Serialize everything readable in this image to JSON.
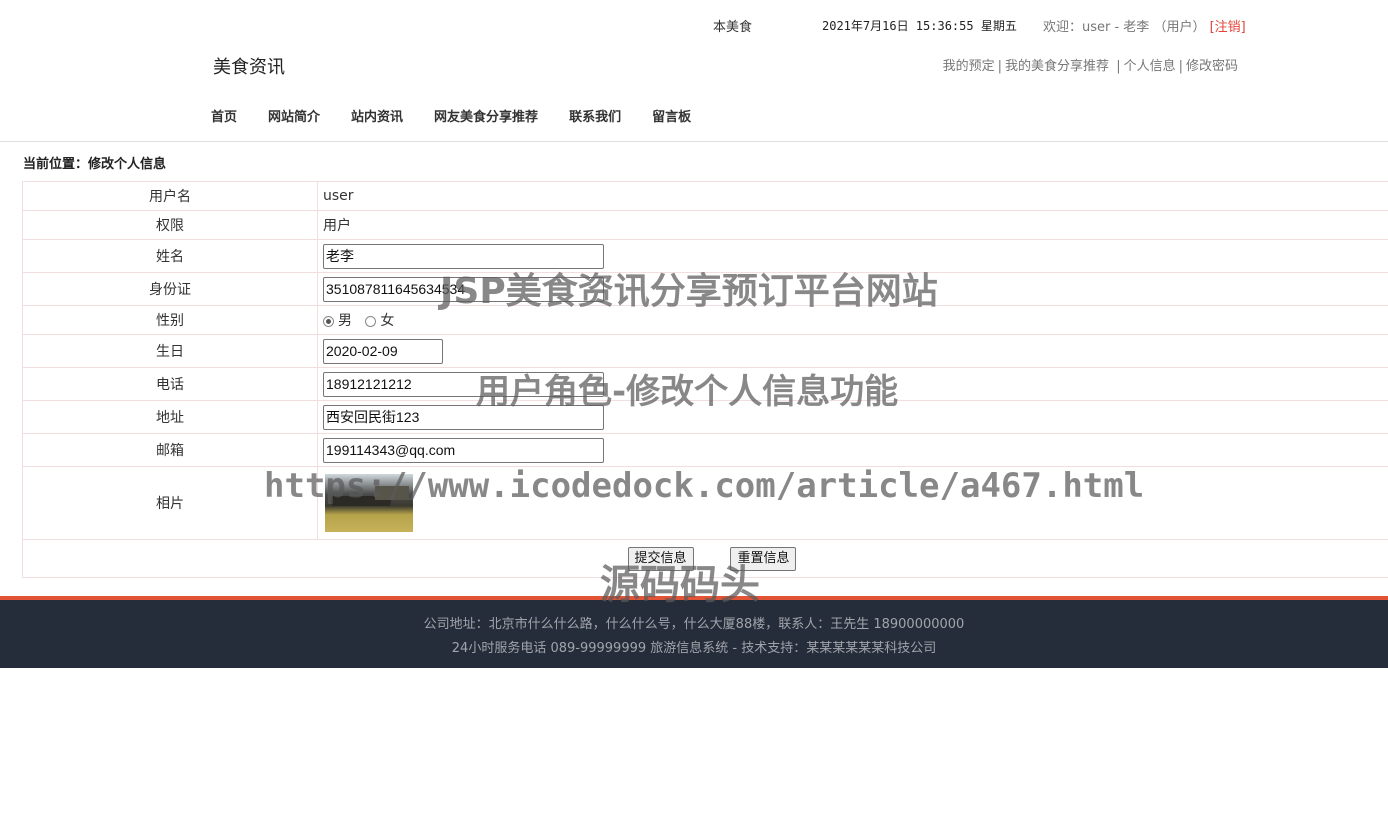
{
  "topbar": {
    "brand_small": "本美食",
    "clock": "2021年7月16日 15:36:55 星期五",
    "welcome": "欢迎：user - 老李 （用户）",
    "logout": "[注销]"
  },
  "header": {
    "site_title": "美食资讯",
    "user_links": [
      "我的预定",
      "我的美食分享推荐",
      "个人信息",
      "修改密码"
    ],
    "nav": [
      "首页",
      "网站简介",
      "站内资讯",
      "网友美食分享推荐",
      "联系我们",
      "留言板"
    ]
  },
  "breadcrumb": "当前位置：修改个人信息",
  "form": {
    "username_label": "用户名",
    "username_value": "user",
    "role_label": "权限",
    "role_value": "用户",
    "name_label": "姓名",
    "name_value": "老李",
    "id_label": "身份证",
    "id_value": "351087811645634534",
    "gender_label": "性别",
    "gender_male": "男",
    "gender_female": "女",
    "birthday_label": "生日",
    "birthday_value": "2020-02-09",
    "phone_label": "电话",
    "phone_value": "18912121212",
    "address_label": "地址",
    "address_value": "西安回民街123",
    "email_label": "邮箱",
    "email_value": "199114343@qq.com",
    "photo_label": "相片",
    "submit_label": "提交信息",
    "reset_label": "重置信息"
  },
  "footer": {
    "line1": "公司地址：北京市什么什么路，什么什么号，什么大厦88楼，联系人：王先生 18900000000",
    "line2": "24小时服务电话   089-99999999   旅游信息系统 - 技术支持：某某某某某某科技公司"
  },
  "watermarks": [
    "JSP美食资讯分享预订平台网站",
    "用户角色-修改个人信息功能",
    "https://www.icodedock.com/article/a467.html",
    "源码码头"
  ]
}
